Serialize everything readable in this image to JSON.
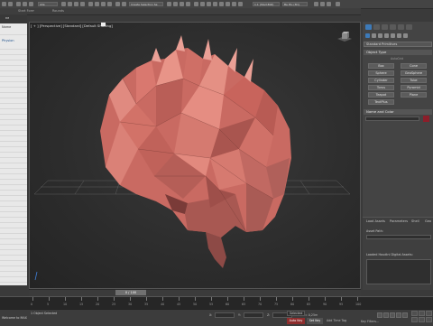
{
  "toolbar": {
    "selection_filter": "Alle",
    "named_selection": "Create Selection Se",
    "keyboard_shortcut": "1.1 (Stad.Bild)",
    "user_label": "Be Plu (3D)"
  },
  "ribbon": {
    "tabs": [
      "Start Form",
      "Rounds"
    ]
  },
  "scene_explorer": {
    "header": "ne",
    "items": [
      "Name",
      "Physion"
    ]
  },
  "viewport": {
    "label": "[ + ] [Perspective] [Standard] [Default Shading]"
  },
  "command_panel": {
    "category_dropdown": "Standard Primitives",
    "object_type_title": "Object Type",
    "autogrid_label": "AutoGrid",
    "object_buttons": [
      "Box",
      "Cone",
      "Sphere",
      "GeoSphere",
      "Cylinder",
      "Tube",
      "Torus",
      "Pyramid",
      "Teapot",
      "Plane",
      "TextPlus"
    ],
    "name_color_title": "Name and Color",
    "object_color": "#8c1e2a",
    "asset_tabs": [
      "Load Assets",
      "Parameters",
      "Shell",
      "Geo"
    ],
    "asset_path_label": "Asset Path:",
    "loaded_assets_label": "Loaded Houdini Digital Assets:"
  },
  "timeline": {
    "position_label": "0 / 100",
    "ticks": [
      "0",
      "5",
      "10",
      "15",
      "20",
      "25",
      "30",
      "35",
      "40",
      "45",
      "50",
      "55",
      "60",
      "65",
      "70",
      "75",
      "80",
      "85",
      "90",
      "95",
      "100"
    ]
  },
  "statusbar": {
    "left_text": "Welcome to MAXScript.",
    "selection_info": "1 Object Selected",
    "x_label": "X:",
    "y_label": "Y:",
    "z_label": "Z:",
    "grid_label": "Grid = 0,25m",
    "add_time_tag": "Add Time Tag",
    "autokey_label": "Auto Key",
    "setkey_label": "Set Key",
    "selected_label": "Selected",
    "key_filters": "Key Filters..."
  }
}
